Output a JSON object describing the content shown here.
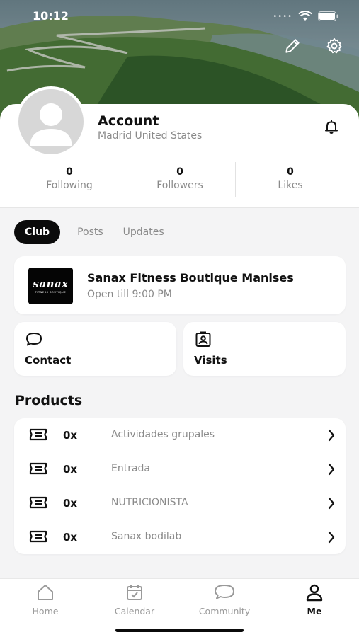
{
  "status_bar": {
    "time": "10:12"
  },
  "profile": {
    "name": "Account",
    "location": "Madrid United States",
    "stats": [
      {
        "value": "0",
        "label": "Following"
      },
      {
        "value": "0",
        "label": "Followers"
      },
      {
        "value": "0",
        "label": "Likes"
      }
    ]
  },
  "tabs": [
    {
      "label": "Club",
      "active": true
    },
    {
      "label": "Posts",
      "active": false
    },
    {
      "label": "Updates",
      "active": false
    }
  ],
  "club": {
    "logo_text": "sanax",
    "logo_subtext": "FITNESS BOUTIQUE",
    "name": "Sanax Fitness Boutique Manises",
    "hours": "Open till 9:00 PM"
  },
  "actions": {
    "contact_label": "Contact",
    "visits_label": "Visits"
  },
  "products": {
    "title": "Products",
    "items": [
      {
        "qty": "0x",
        "name": "Actividades grupales"
      },
      {
        "qty": "0x",
        "name": "Entrada"
      },
      {
        "qty": "0x",
        "name": "NUTRICIONISTA"
      },
      {
        "qty": "0x",
        "name": "Sanax bodilab"
      }
    ]
  },
  "bottom_nav": [
    {
      "label": "Home",
      "icon": "home-icon",
      "active": false
    },
    {
      "label": "Calendar",
      "icon": "calendar-icon",
      "active": false
    },
    {
      "label": "Community",
      "icon": "chat-bubble-icon",
      "active": false
    },
    {
      "label": "Me",
      "icon": "person-icon",
      "active": true
    }
  ],
  "colors": {
    "accent": "#0b0b0b",
    "muted_text": "#8a8a8a",
    "background": "#f4f4f5"
  }
}
